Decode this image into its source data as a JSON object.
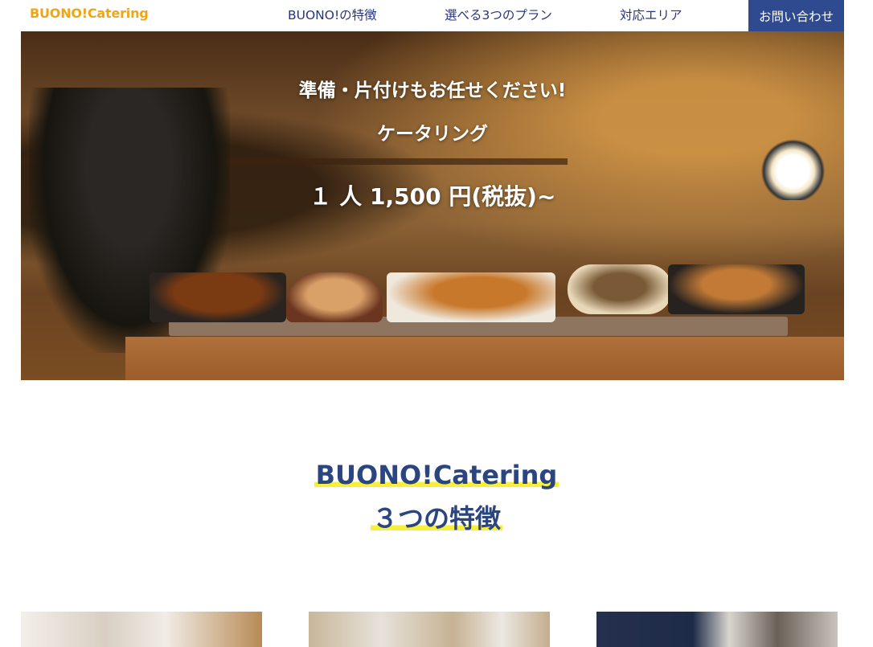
{
  "header": {
    "logo": "BUONO!Catering",
    "nav": [
      "BUONO!の特徴",
      "選べる3つのプラン",
      "対応エリア"
    ],
    "contact_label": "お問い合わせ"
  },
  "hero": {
    "line1": "準備・片付けもお任せください!",
    "line2": "ケータリング",
    "line3": "１ 人 1,500 円(税抜)~"
  },
  "section": {
    "title_line1": "BUONO!Catering",
    "title_line2": "３つの特徴"
  },
  "colors": {
    "logo": "#f0a516",
    "nav_text": "#28357a",
    "contact_bg": "#2f4a8f",
    "heading": "#2a4580",
    "highlight": "#f7ef3a"
  }
}
